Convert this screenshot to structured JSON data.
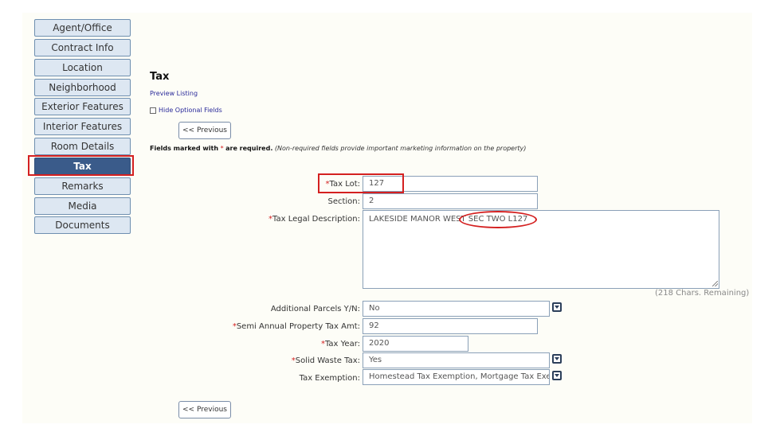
{
  "sidebar": {
    "items": [
      {
        "label": "Agent/Office"
      },
      {
        "label": "Contract Info"
      },
      {
        "label": "Location"
      },
      {
        "label": "Neighborhood"
      },
      {
        "label": "Exterior Features"
      },
      {
        "label": "Interior Features"
      },
      {
        "label": "Room Details"
      },
      {
        "label": "Tax",
        "active": true
      },
      {
        "label": "Remarks"
      },
      {
        "label": "Media"
      },
      {
        "label": "Documents"
      }
    ]
  },
  "page": {
    "title": "Tax",
    "preview_link": "Preview Listing",
    "hide_optional_label": "Hide Optional Fields",
    "hide_optional_checked": false,
    "prev_button": "<< Previous",
    "required_note_bold_pre": "Fields marked with",
    "required_star": "*",
    "required_note_bold_post": "are required.",
    "required_note_italic": "(Non-required fields provide important marketing information on the property)"
  },
  "form": {
    "tax_lot": {
      "label": "Tax Lot:",
      "value": "127",
      "required": true
    },
    "section": {
      "label": "Section:",
      "value": "2",
      "required": false
    },
    "legal_desc": {
      "label": "Tax Legal Description:",
      "value": "LAKESIDE MANOR WEST SEC TWO L127",
      "required": true,
      "remaining": "(218 Chars. Remaining)"
    },
    "additional_parcels": {
      "label": "Additional Parcels Y/N:",
      "value": "No",
      "required": false
    },
    "semi_annual_tax": {
      "label": "Semi Annual Property Tax Amt:",
      "value": "92",
      "required": true
    },
    "tax_year": {
      "label": "Tax Year:",
      "value": "2020",
      "required": true
    },
    "solid_waste": {
      "label": "Solid Waste Tax:",
      "value": "Yes",
      "required": true
    },
    "tax_exemption": {
      "label": "Tax Exemption:",
      "value": "Homestead Tax Exemption, Mortgage Tax Exe",
      "required": false
    }
  },
  "colors": {
    "required_star": "#d42020",
    "active_nav": "#3a5b8a",
    "annotation": "#d42020"
  }
}
